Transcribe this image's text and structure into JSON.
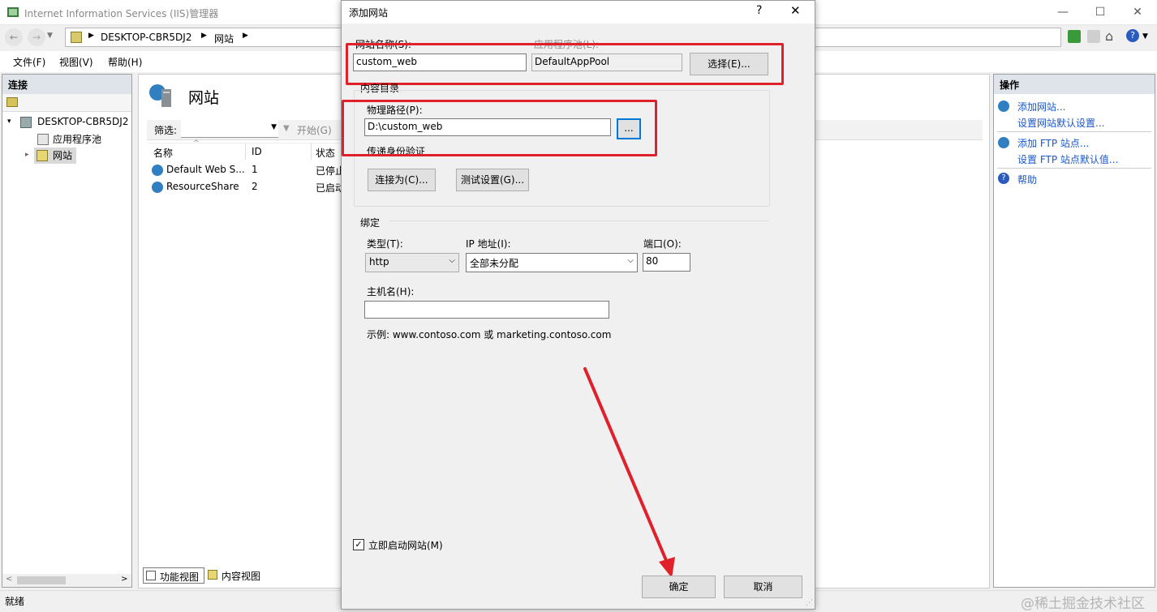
{
  "window": {
    "title": "Internet Information Services (IIS)管理器"
  },
  "address": {
    "segments": [
      "DESKTOP-CBR5DJ2",
      "网站"
    ]
  },
  "menu": {
    "items": [
      "文件(F)",
      "视图(V)",
      "帮助(H)"
    ]
  },
  "connections": {
    "header": "连接",
    "tree": {
      "root": "DESKTOP-CBR5DJ2",
      "children": [
        "应用程序池",
        "网站"
      ]
    }
  },
  "center": {
    "title": "网站",
    "filter_label": "筛选:",
    "start_label": "开始(G)",
    "columns": [
      "名称",
      "ID",
      "状态"
    ],
    "rows": [
      {
        "name": "Default Web S...",
        "id": "1",
        "status": "已停止"
      },
      {
        "name": "ResourceShare",
        "id": "2",
        "status": "已启动"
      }
    ],
    "tabs": [
      "功能视图",
      "内容视图"
    ]
  },
  "actions": {
    "header": "操作",
    "links": [
      "添加网站...",
      "设置网站默认设置...",
      "添加 FTP 站点...",
      "设置 FTP 站点默认值...",
      "帮助"
    ]
  },
  "status": {
    "text": "就绪"
  },
  "dialog": {
    "title": "添加网站",
    "help": "?",
    "site_name_label": "网站名称(S):",
    "site_name_value": "custom_web",
    "app_pool_label": "应用程序池(L):",
    "app_pool_value": "DefaultAppPool",
    "select_button": "选择(E)...",
    "content_dir_label": "内容目录",
    "physical_path_label": "物理路径(P):",
    "physical_path_value": "D:\\custom_web",
    "browse_button": "...",
    "passthrough_label": "传递身份验证",
    "connect_as_button": "连接为(C)...",
    "test_settings_button": "测试设置(G)...",
    "binding_label": "绑定",
    "type_label": "类型(T):",
    "type_value": "http",
    "ip_label": "IP 地址(I):",
    "ip_value": "全部未分配",
    "port_label": "端口(O):",
    "port_value": "80",
    "host_label": "主机名(H):",
    "host_value": "",
    "example": "示例: www.contoso.com 或 marketing.contoso.com",
    "start_checkbox_label": "立即启动网站(M)",
    "ok_button": "确定",
    "cancel_button": "取消"
  },
  "watermark": "@稀土掘金技术社区",
  "colors": {
    "highlight": "#e0202a",
    "link": "#1a57c8",
    "pane_header": "#dfe4ea"
  }
}
